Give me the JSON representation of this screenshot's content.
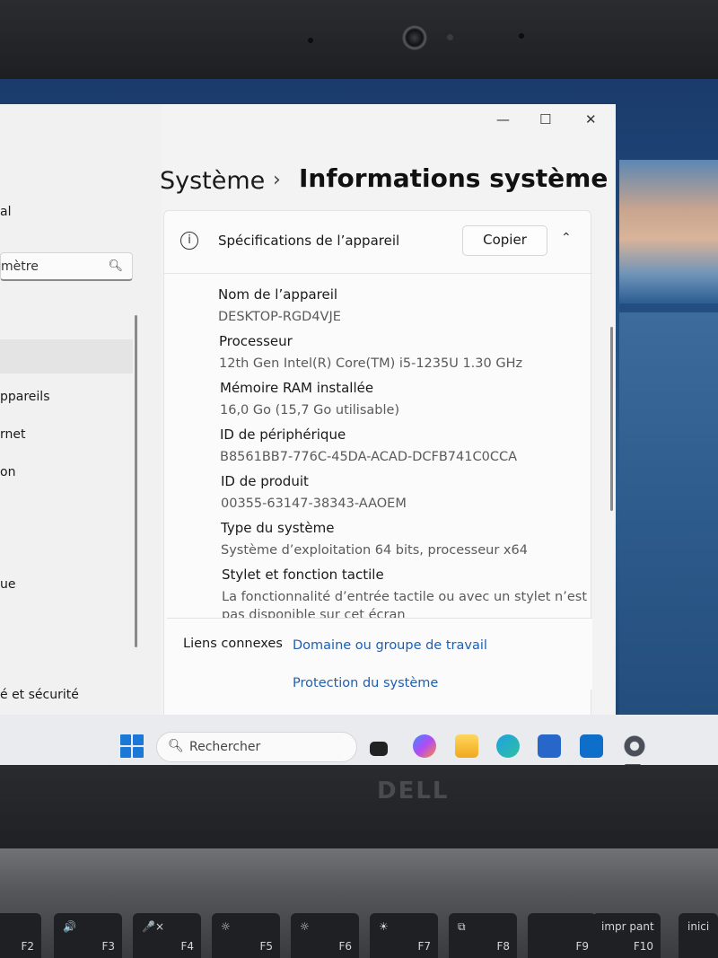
{
  "left_panel": {
    "text_top": "al",
    "search_placeholder": "mètre",
    "items": [
      "ppareils",
      "rnet",
      "on",
      "ue",
      "é et sécurité"
    ]
  },
  "window": {
    "breadcrumb_parent": "Système",
    "breadcrumb_current": "Informations système",
    "controls": {
      "minimize": "—",
      "maximize": "☐",
      "close": "✕"
    }
  },
  "specs": {
    "title": "Spécifications de l’appareil",
    "copy_label": "Copier",
    "rows": [
      {
        "label": "Nom de l’appareil",
        "value": "DESKTOP-RGD4VJE"
      },
      {
        "label": "Processeur",
        "value": "12th Gen Intel(R) Core(TM) i5-1235U   1.30 GHz"
      },
      {
        "label": "Mémoire RAM installée",
        "value": "16,0 Go (15,7 Go utilisable)"
      },
      {
        "label": "ID de périphérique",
        "value": "B8561BB7-776C-45DA-ACAD-DCFB741C0CCA"
      },
      {
        "label": "ID de produit",
        "value": "00355-63147-38343-AAOEM"
      },
      {
        "label": "Type du système",
        "value": "Système d’exploitation 64 bits, processeur x64"
      },
      {
        "label": "Stylet et fonction tactile",
        "value": "La fonctionnalité d’entrée tactile ou avec un stylet n’est",
        "value2": "pas disponible sur cet écran"
      }
    ]
  },
  "related": {
    "label": "Liens connexes",
    "links": [
      "Domaine ou groupe de travail",
      "Protection du système"
    ]
  },
  "taskbar": {
    "search_placeholder": "Rechercher"
  },
  "brand": "DELL",
  "keys": [
    {
      "fn": "F2",
      "sym": "🔈"
    },
    {
      "fn": "F3",
      "sym": "🔊"
    },
    {
      "fn": "F4",
      "sym": "🎤×"
    },
    {
      "fn": "F5",
      "sym": "☼"
    },
    {
      "fn": "F6",
      "sym": "☼"
    },
    {
      "fn": "F7",
      "sym": "☀"
    },
    {
      "fn": "F8",
      "sym": "⧉"
    },
    {
      "fn": "F9",
      "sym": ""
    },
    {
      "fn": "F10",
      "sym": "impr pant"
    },
    {
      "fn": "",
      "sym": "inici"
    }
  ]
}
